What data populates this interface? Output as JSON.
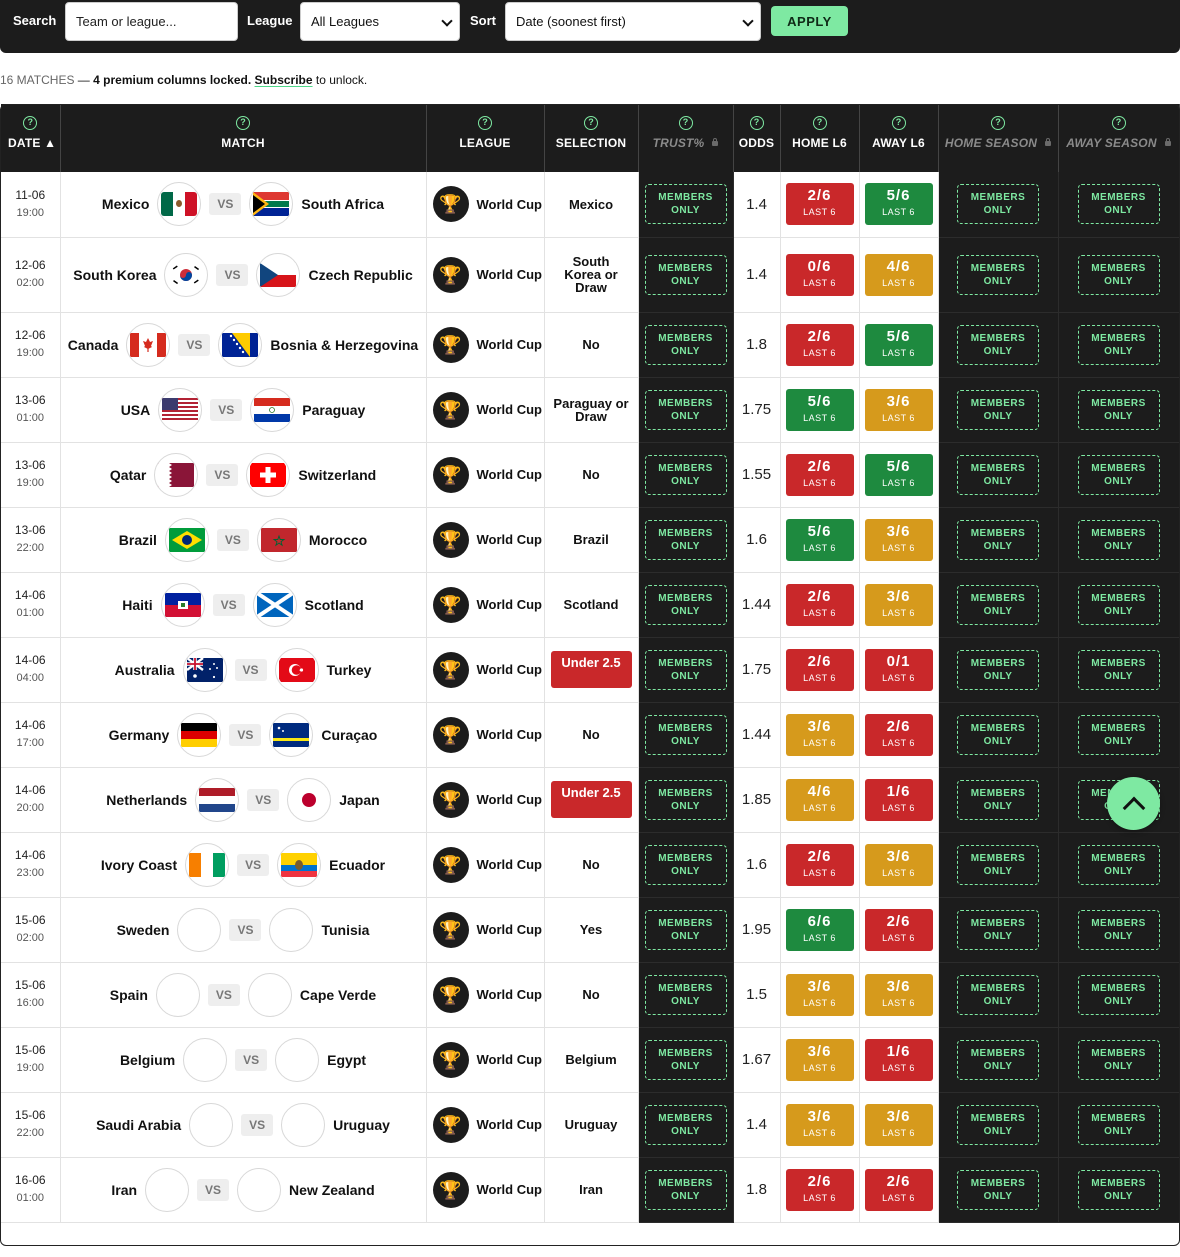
{
  "filters": {
    "search_label": "Search",
    "search_placeholder": "Team or league...",
    "league_label": "League",
    "league_value": "All Leagues",
    "sort_label": "Sort",
    "sort_value": "Date (soonest first)",
    "apply_label": "APPLY"
  },
  "info": {
    "count": "16 MATCHES",
    "dash": " — ",
    "locked": "4 premium columns locked.",
    "subscribe": "Subscribe",
    "rest": " to unlock."
  },
  "headers": {
    "date": "DATE ▲",
    "match": "MATCH",
    "league": "LEAGUE",
    "selection": "SELECTION",
    "trust": "TRUST%",
    "odds": "ODDS",
    "home_l6": "HOME L6",
    "away_l6": "AWAY L6",
    "home_season": "HOME SEASON",
    "away_season": "AWAY SEASON",
    "help": "?"
  },
  "members": {
    "line1": "MEMBERS",
    "line2": "ONLY"
  },
  "last_label": "LAST 6",
  "vs_label": "VS",
  "colors": {
    "accent": "#7ee9a2",
    "red": "#c9282a",
    "green": "#1e8a3f",
    "amber": "#d69a1c",
    "dark": "#1c1c1c"
  },
  "rows": [
    {
      "date": "11-06",
      "time": "19:00",
      "home": "Mexico",
      "away": "South Africa",
      "league": "World Cup",
      "sel": "Mexico",
      "sel_style": "plain",
      "odds": "1.4",
      "hl6": "2/6",
      "hl6_color": "red",
      "al6": "5/6",
      "al6_color": "green",
      "hflag": "mexico-flag",
      "aflag": "south-africa-flag"
    },
    {
      "date": "12-06",
      "time": "02:00",
      "home": "South Korea",
      "away": "Czech Republic",
      "league": "World Cup",
      "sel": "South Korea or Draw",
      "sel_style": "plain",
      "odds": "1.4",
      "hl6": "0/6",
      "hl6_color": "red",
      "al6": "4/6",
      "al6_color": "amber",
      "hflag": "south-korea-flag",
      "aflag": "czech-republic-flag"
    },
    {
      "date": "12-06",
      "time": "19:00",
      "home": "Canada",
      "away": "Bosnia & Herzegovina",
      "league": "World Cup",
      "sel": "No",
      "sel_style": "plain",
      "odds": "1.8",
      "hl6": "2/6",
      "hl6_color": "red",
      "al6": "5/6",
      "al6_color": "green",
      "hflag": "canada-flag",
      "aflag": "bosnia-flag"
    },
    {
      "date": "13-06",
      "time": "01:00",
      "home": "USA",
      "away": "Paraguay",
      "league": "World Cup",
      "sel": "Paraguay or Draw",
      "sel_style": "plain",
      "odds": "1.75",
      "hl6": "5/6",
      "hl6_color": "green",
      "al6": "3/6",
      "al6_color": "amber",
      "hflag": "usa-flag",
      "aflag": "paraguay-flag"
    },
    {
      "date": "13-06",
      "time": "19:00",
      "home": "Qatar",
      "away": "Switzerland",
      "league": "World Cup",
      "sel": "No",
      "sel_style": "plain",
      "odds": "1.55",
      "hl6": "2/6",
      "hl6_color": "red",
      "al6": "5/6",
      "al6_color": "green",
      "hflag": "qatar-flag",
      "aflag": "switzerland-flag"
    },
    {
      "date": "13-06",
      "time": "22:00",
      "home": "Brazil",
      "away": "Morocco",
      "league": "World Cup",
      "sel": "Brazil",
      "sel_style": "plain",
      "odds": "1.6",
      "hl6": "5/6",
      "hl6_color": "green",
      "al6": "3/6",
      "al6_color": "amber",
      "hflag": "brazil-flag",
      "aflag": "morocco-flag"
    },
    {
      "date": "14-06",
      "time": "01:00",
      "home": "Haiti",
      "away": "Scotland",
      "league": "World Cup",
      "sel": "Scotland",
      "sel_style": "plain",
      "odds": "1.44",
      "hl6": "2/6",
      "hl6_color": "red",
      "al6": "3/6",
      "al6_color": "amber",
      "hflag": "haiti-flag",
      "aflag": "scotland-flag"
    },
    {
      "date": "14-06",
      "time": "04:00",
      "home": "Australia",
      "away": "Turkey",
      "league": "World Cup",
      "sel": "Under 2.5",
      "sel_style": "red",
      "odds": "1.75",
      "hl6": "2/6",
      "hl6_color": "red",
      "al6": "0/1",
      "al6_color": "red",
      "hflag": "australia-flag",
      "aflag": "turkey-flag"
    },
    {
      "date": "14-06",
      "time": "17:00",
      "home": "Germany",
      "away": "Curaçao",
      "league": "World Cup",
      "sel": "No",
      "sel_style": "plain",
      "odds": "1.44",
      "hl6": "3/6",
      "hl6_color": "amber",
      "al6": "2/6",
      "al6_color": "red",
      "hflag": "germany-flag",
      "aflag": "curacao-flag"
    },
    {
      "date": "14-06",
      "time": "20:00",
      "home": "Netherlands",
      "away": "Japan",
      "league": "World Cup",
      "sel": "Under 2.5",
      "sel_style": "red",
      "odds": "1.85",
      "hl6": "4/6",
      "hl6_color": "amber",
      "al6": "1/6",
      "al6_color": "red",
      "hflag": "netherlands-flag",
      "aflag": "japan-flag"
    },
    {
      "date": "14-06",
      "time": "23:00",
      "home": "Ivory Coast",
      "away": "Ecuador",
      "league": "World Cup",
      "sel": "No",
      "sel_style": "plain",
      "odds": "1.6",
      "hl6": "2/6",
      "hl6_color": "red",
      "al6": "3/6",
      "al6_color": "amber",
      "hflag": "ivory-coast-flag",
      "aflag": "ecuador-flag"
    },
    {
      "date": "15-06",
      "time": "02:00",
      "home": "Sweden",
      "away": "Tunisia",
      "league": "World Cup",
      "sel": "Yes",
      "sel_style": "plain",
      "odds": "1.95",
      "hl6": "6/6",
      "hl6_color": "green",
      "al6": "2/6",
      "al6_color": "red",
      "hflag": "empty",
      "aflag": "empty"
    },
    {
      "date": "15-06",
      "time": "16:00",
      "home": "Spain",
      "away": "Cape Verde",
      "league": "World Cup",
      "sel": "No",
      "sel_style": "plain",
      "odds": "1.5",
      "hl6": "3/6",
      "hl6_color": "amber",
      "al6": "3/6",
      "al6_color": "amber",
      "hflag": "empty",
      "aflag": "empty"
    },
    {
      "date": "15-06",
      "time": "19:00",
      "home": "Belgium",
      "away": "Egypt",
      "league": "World Cup",
      "sel": "Belgium",
      "sel_style": "plain",
      "odds": "1.67",
      "hl6": "3/6",
      "hl6_color": "amber",
      "al6": "1/6",
      "al6_color": "red",
      "hflag": "empty",
      "aflag": "empty"
    },
    {
      "date": "15-06",
      "time": "22:00",
      "home": "Saudi Arabia",
      "away": "Uruguay",
      "league": "World Cup",
      "sel": "Uruguay",
      "sel_style": "plain",
      "odds": "1.4",
      "hl6": "3/6",
      "hl6_color": "amber",
      "al6": "3/6",
      "al6_color": "amber",
      "hflag": "empty",
      "aflag": "empty"
    },
    {
      "date": "16-06",
      "time": "01:00",
      "home": "Iran",
      "away": "New Zealand",
      "league": "World Cup",
      "sel": "Iran",
      "sel_style": "plain",
      "odds": "1.8",
      "hl6": "2/6",
      "hl6_color": "red",
      "al6": "2/6",
      "al6_color": "red",
      "hflag": "empty",
      "aflag": "empty"
    }
  ]
}
